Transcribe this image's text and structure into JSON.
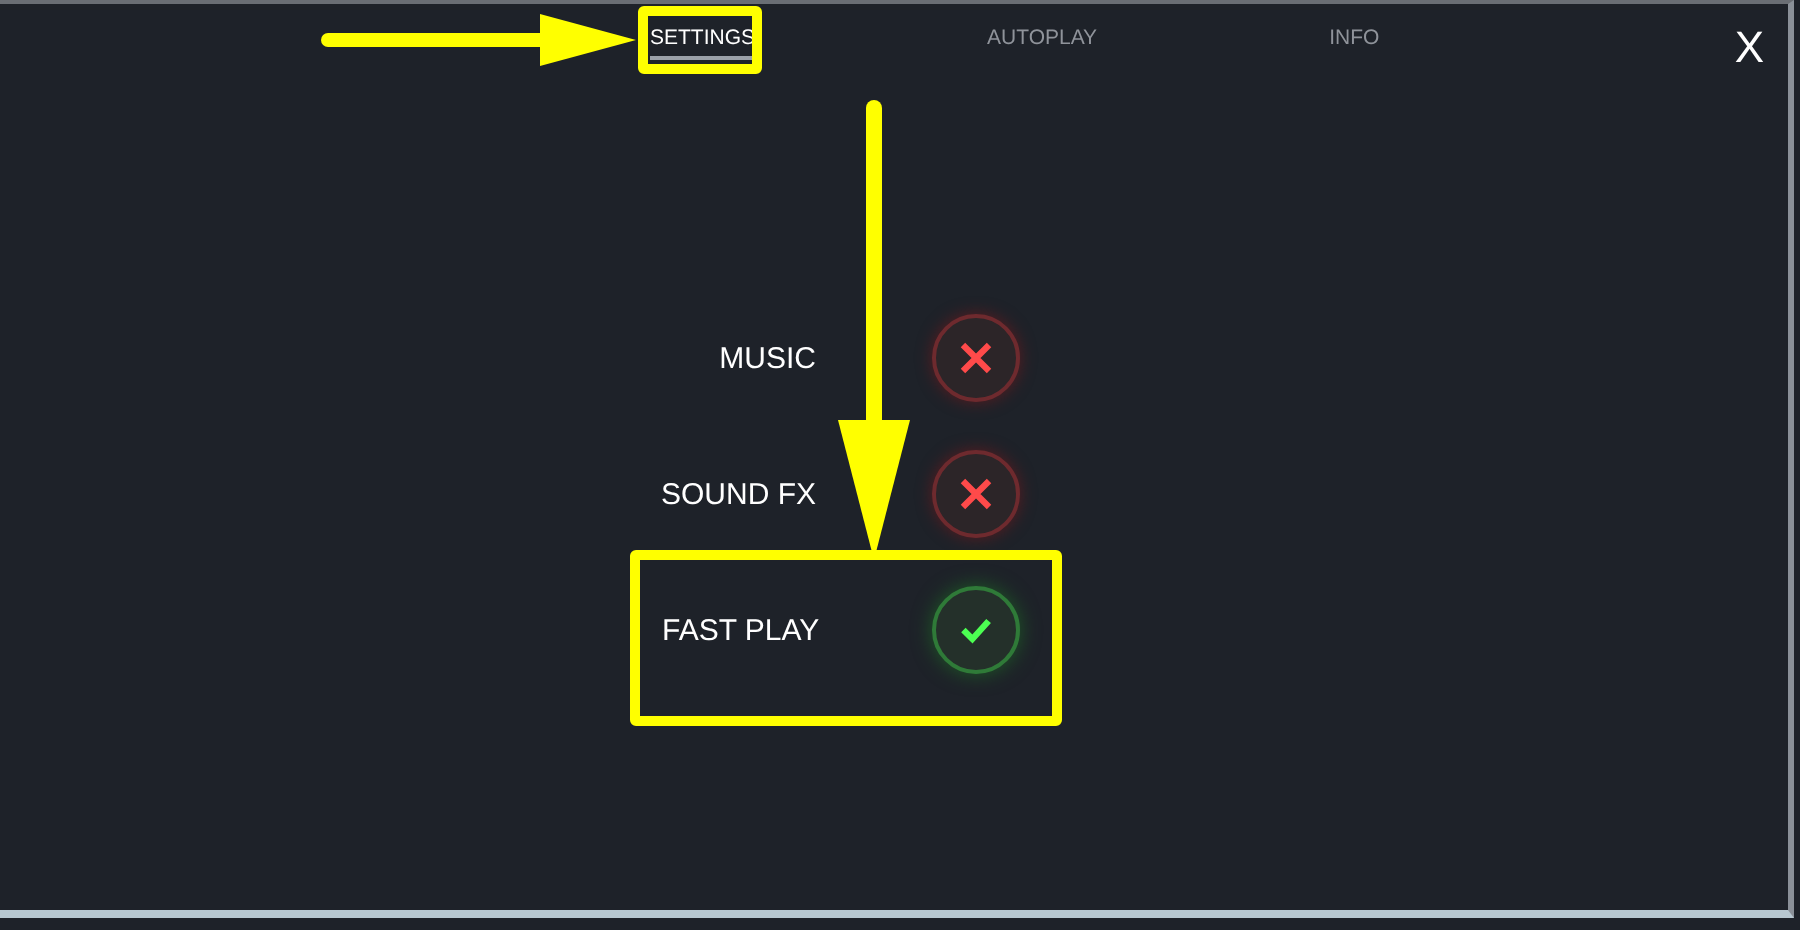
{
  "tabs": [
    {
      "label": "SETTINGS",
      "selected": true
    },
    {
      "label": "AUTOPLAY",
      "selected": false
    },
    {
      "label": "INFO",
      "selected": false
    }
  ],
  "close": "X",
  "settings": [
    {
      "label": "MUSIC",
      "on": false
    },
    {
      "label": "SOUND FX",
      "on": false
    },
    {
      "label": "FAST PLAY",
      "on": true
    }
  ],
  "annotations": [
    {
      "kind": "arrow-right"
    },
    {
      "kind": "tab-box"
    },
    {
      "kind": "arrow-down"
    },
    {
      "kind": "row-box"
    }
  ]
}
